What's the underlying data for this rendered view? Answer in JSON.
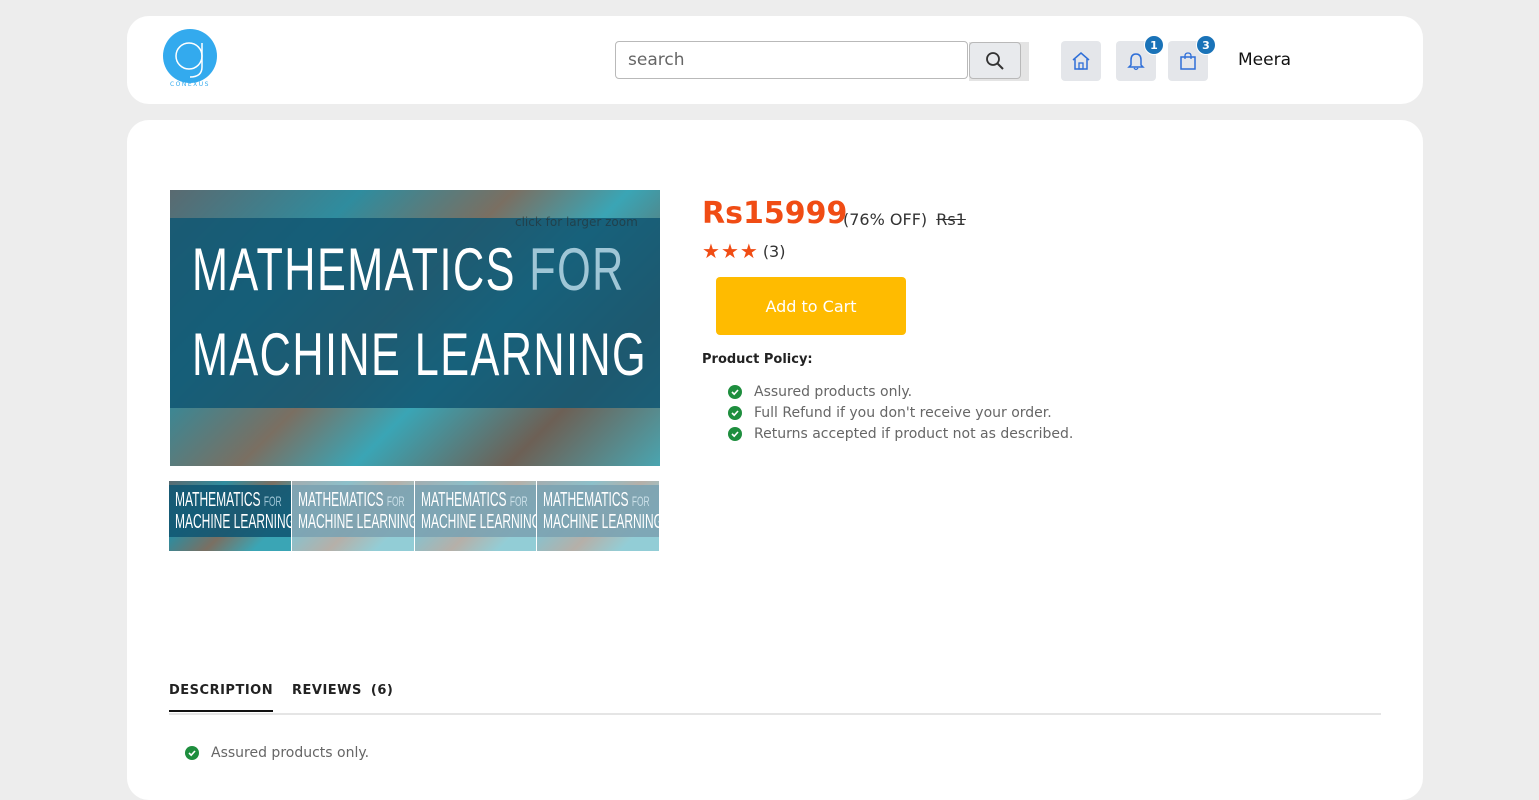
{
  "header": {
    "logo_text": "CONEXUS",
    "search_placeholder": "search",
    "notification_count": "1",
    "cart_count": "3",
    "username": "Meera"
  },
  "product": {
    "cover_line1_main": "MATHEMATICS",
    "cover_line1_for": "FOR",
    "cover_line2": "MACHINE LEARNING",
    "zoom_hint": "click for larger zoom",
    "thumbnails": [
      {
        "line1": "MATHEMATICS",
        "for": "FOR",
        "line2": "MACHINE LEARNING"
      },
      {
        "line1": "MATHEMATICS",
        "for": "FOR",
        "line2": "MACHINE LEARNING"
      },
      {
        "line1": "MATHEMATICS",
        "for": "FOR",
        "line2": "MACHINE LEARNING"
      },
      {
        "line1": "MATHEMATICS",
        "for": "FOR",
        "line2": "MACHINE LEARNING"
      }
    ],
    "price": "Rs15999",
    "discount": "(76% OFF)",
    "old_price": "Rs1",
    "rating_stars": 3,
    "rating_count": "(3)",
    "add_to_cart_label": "Add to Cart",
    "policy_title": "Product Policy:",
    "policy_items": [
      "Assured products only.",
      "Full Refund if you don't receive your order.",
      "Returns accepted if product not as described."
    ]
  },
  "tabs": {
    "description": "DESCRIPTION",
    "reviews": "REVIEWS",
    "reviews_count": "(6)"
  },
  "description_items": [
    "Assured products only."
  ],
  "colors": {
    "accent": "#f04c14",
    "cart_button": "#ffbb00",
    "badge": "#1a73b8",
    "check": "#1e8e3e",
    "logo": "#33aaee"
  }
}
